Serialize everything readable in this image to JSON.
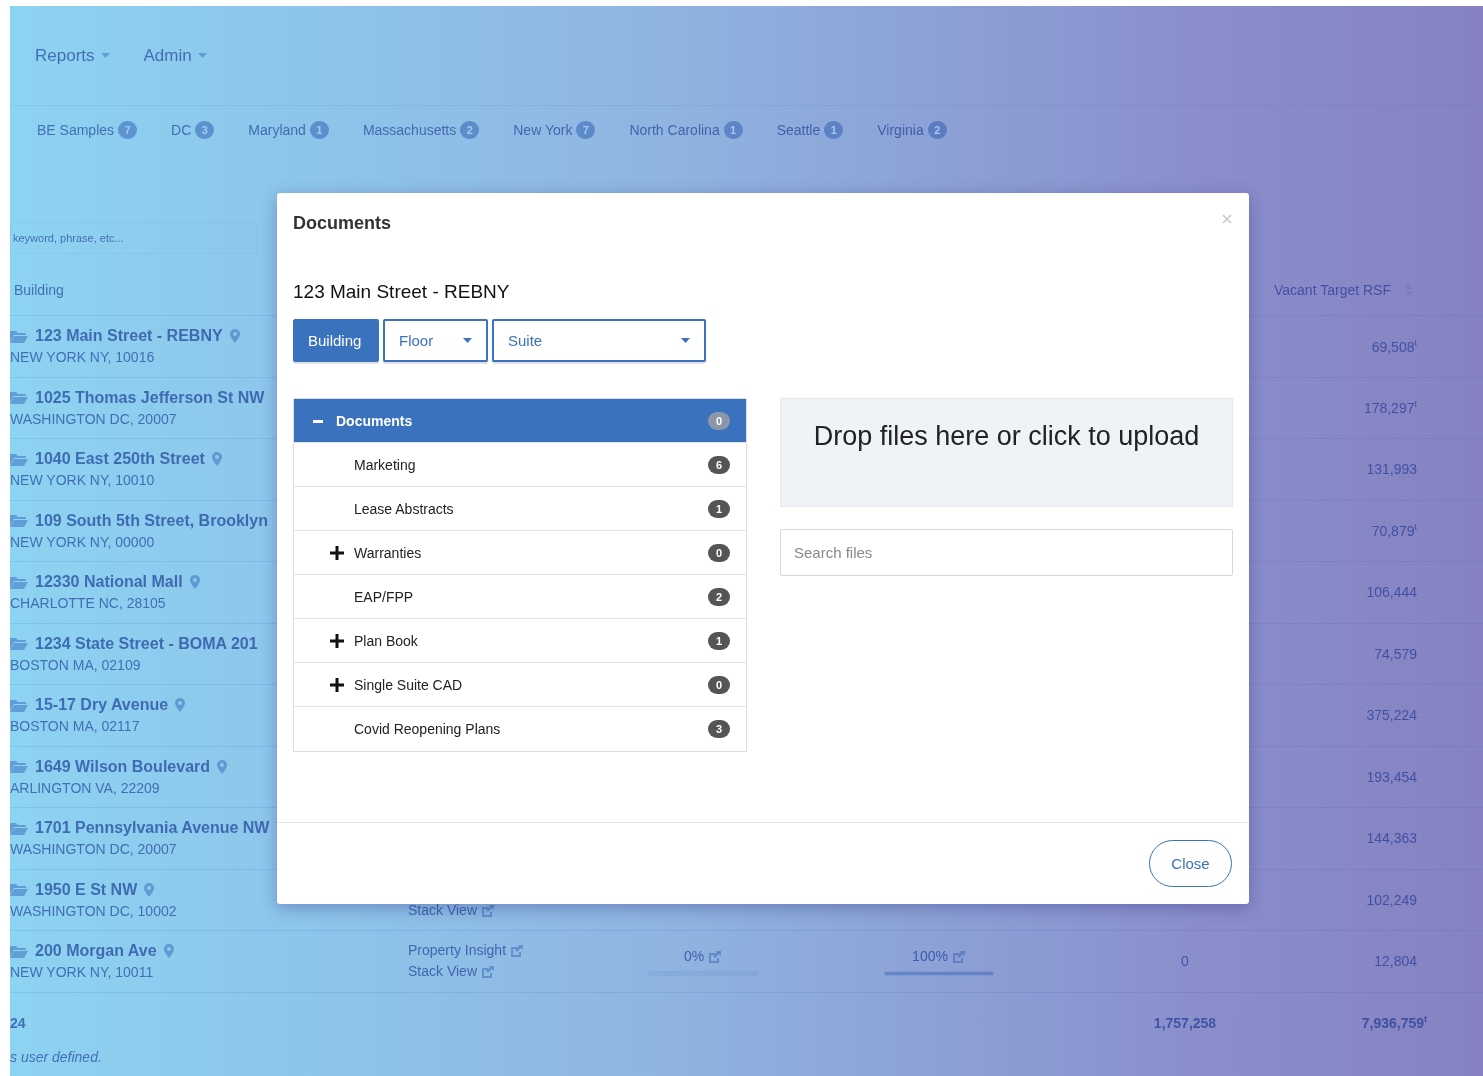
{
  "nav": [
    {
      "label": "Reports",
      "kind": "dropdown"
    },
    {
      "label": "Admin",
      "kind": "dropdown"
    }
  ],
  "tabs": [
    {
      "label": "BE Samples",
      "count": "7",
      "selected": false
    },
    {
      "label": "DC",
      "count": "3",
      "selected": false
    },
    {
      "label": "Maryland",
      "count": "1",
      "selected": false
    },
    {
      "label": "Massachusetts",
      "count": "2",
      "selected": false
    },
    {
      "label": "New York",
      "count": "7",
      "selected": false
    },
    {
      "label": "North Carolina",
      "count": "1",
      "selected": false
    },
    {
      "label": "Seattle",
      "count": "1",
      "selected": false
    },
    {
      "label": "Virginia",
      "count": "2",
      "selected": false
    }
  ],
  "search": {
    "placeholder": "keyword, phrase, etc..."
  },
  "table": {
    "columns": [
      "Building",
      "Vacant Target RSF"
    ],
    "rows": [
      {
        "name": "123 Main Street - REBNY",
        "pin": true,
        "address": "NEW YORK NY, 10016",
        "vacant": "69,508$^{t}$"
      },
      {
        "name": "1025 Thomas Jefferson St NW",
        "pin": false,
        "address": "WASHINGTON DC, 20007",
        "vacant": "178,297$^{t}$"
      },
      {
        "name": "1040 East 250th Street",
        "pin": true,
        "address": "NEW YORK NY, 10010",
        "vacant": "131,993"
      },
      {
        "name": "109 South 5th Street, Brooklyn",
        "pin": false,
        "address": "NEW YORK NY, 00000",
        "vacant": "70,879$^{t}$"
      },
      {
        "name": "12330 National Mall",
        "pin": true,
        "address": "CHARLOTTE NC, 28105",
        "vacant": "106,444"
      },
      {
        "name": "1234 State Street - BOMA 201",
        "pin": false,
        "address": "BOSTON MA, 02109",
        "vacant": "74,579"
      },
      {
        "name": "15-17 Dry Avenue",
        "pin": true,
        "address": "BOSTON MA, 02117",
        "vacant": "375,224"
      },
      {
        "name": "1649 Wilson Boulevard",
        "pin": true,
        "address": "ARLINGTON VA, 22209",
        "vacant": "193,454"
      },
      {
        "name": "1701 Pennsylvania Avenue NW",
        "pin": false,
        "address": "WASHINGTON DC, 20007",
        "vacant": "144,363"
      },
      {
        "name": "1950 E St NW",
        "pin": true,
        "address": "WASHINGTON DC, 10002",
        "links": [
          "Stack View"
        ],
        "vacant": "102,249"
      },
      {
        "name": "200 Morgan Ave",
        "pin": true,
        "address": "NEW YORK NY, 10011",
        "links": [
          "Property Insight",
          "Stack View"
        ],
        "pct1": {
          "label": "0%",
          "level": 0
        },
        "pct2": {
          "label": "100%",
          "level": 1
        },
        "col5": "0",
        "vacant": "12,804"
      }
    ],
    "footer": {
      "count": "24",
      "col5": "1,757,258",
      "vacant": "7,936,759$^{t}$"
    },
    "note": "s user defined."
  },
  "modal": {
    "title": "Documents",
    "subtitle": "123 Main Street - REBNY",
    "scopes": [
      {
        "label": "Building",
        "kind": "button",
        "selected": true
      },
      {
        "label": "Floor",
        "kind": "dropdown",
        "selected": false
      },
      {
        "label": "Suite",
        "kind": "dropdown",
        "selected": false
      }
    ],
    "tree": {
      "label": "Documents",
      "count": "0",
      "expanded": true,
      "selected": true,
      "children": [
        {
          "label": "Marketing",
          "count": "6",
          "expandable": false
        },
        {
          "label": "Lease Abstracts",
          "count": "1",
          "expandable": false
        },
        {
          "label": "Warranties",
          "count": "0",
          "expandable": true
        },
        {
          "label": "EAP/FPP",
          "count": "2",
          "expandable": false
        },
        {
          "label": "Plan Book",
          "count": "1",
          "expandable": true
        },
        {
          "label": "Single Suite CAD",
          "count": "0",
          "expandable": true
        },
        {
          "label": "Covid Reopening Plans",
          "count": "3",
          "expandable": false
        }
      ]
    },
    "dropzone": "Drop files here or click to upload",
    "file_search": {
      "placeholder": "Search files"
    },
    "close_button": "Close"
  }
}
